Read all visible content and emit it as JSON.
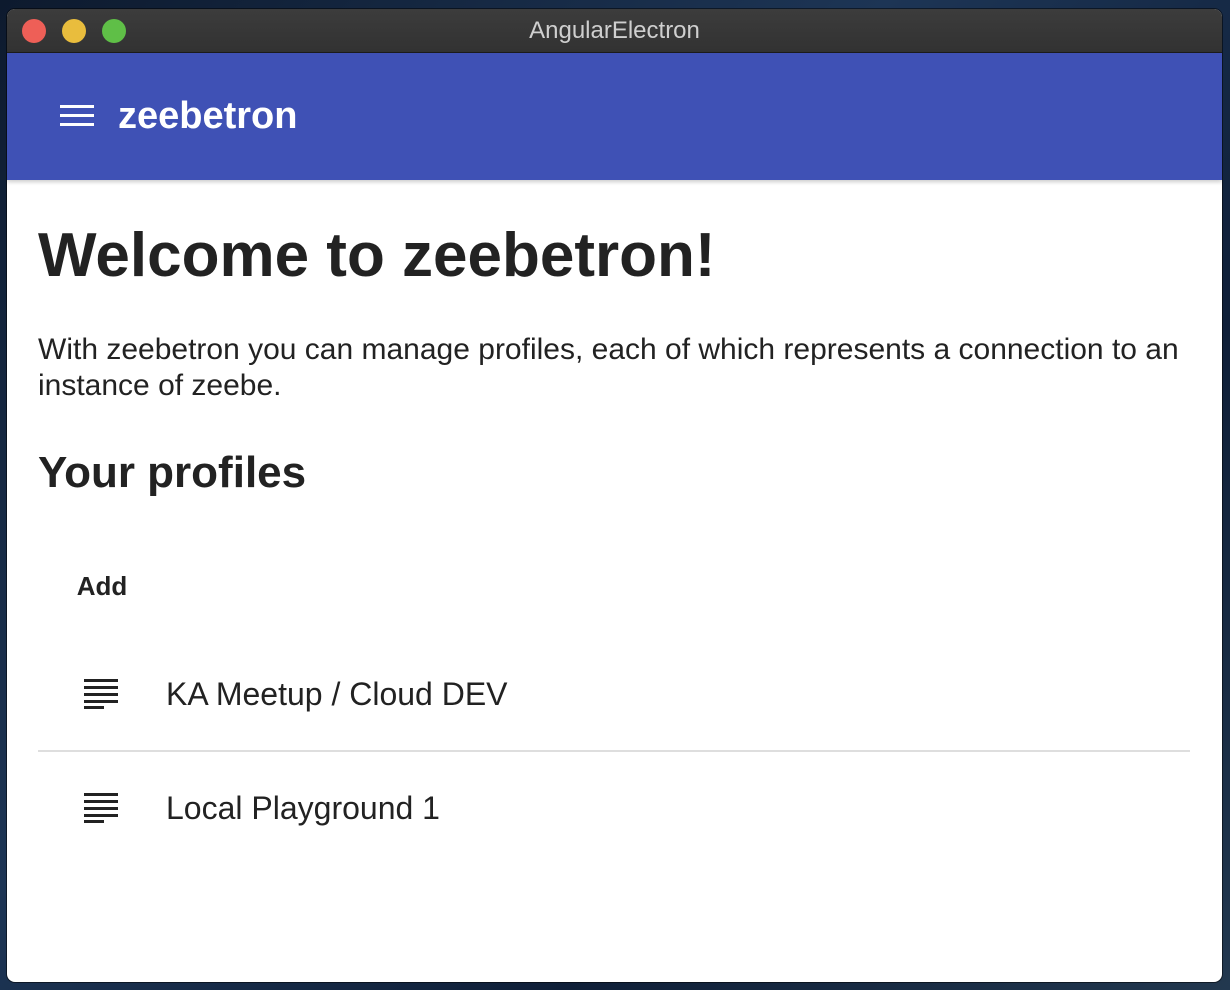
{
  "window": {
    "title": "AngularElectron"
  },
  "toolbar": {
    "menu_icon": "hamburger-menu-icon",
    "app_name": "zeebetron",
    "color": "#3f51b5"
  },
  "main": {
    "heading": "Welcome to zeebetron!",
    "intro": "With zeebetron you can manage profiles, each of which represents a connection to an instance of zeebe.",
    "profiles_heading": "Your profiles",
    "add_label": "Add"
  },
  "profiles": [
    {
      "name": "KA Meetup / Cloud DEV",
      "icon": "notes-icon"
    },
    {
      "name": "Local Playground 1",
      "icon": "notes-icon"
    }
  ]
}
